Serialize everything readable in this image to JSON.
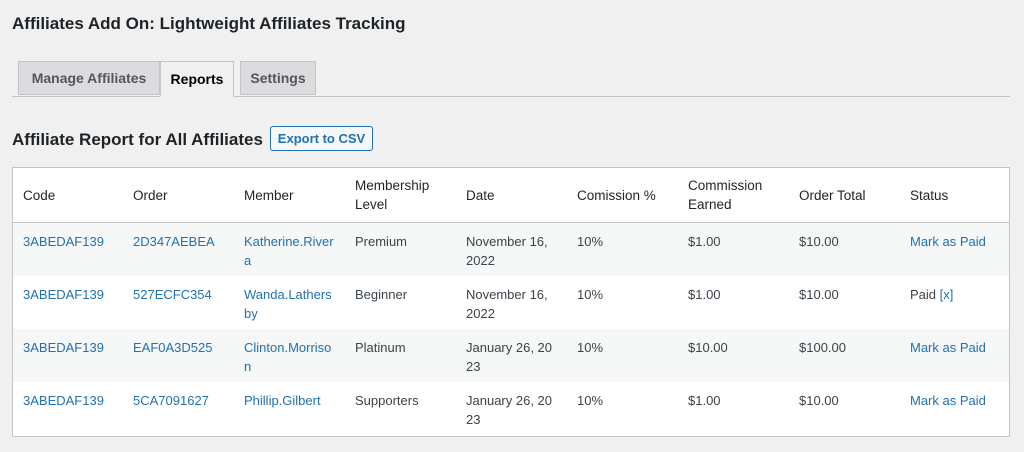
{
  "page_title": "Affiliates Add On: Lightweight Affiliates Tracking",
  "tabs": [
    {
      "label": "Manage Affiliates"
    },
    {
      "label": "Reports"
    },
    {
      "label": "Settings"
    }
  ],
  "report": {
    "title": "Affiliate Report for All Affiliates",
    "export_label": "Export to CSV"
  },
  "table": {
    "headers": [
      "Code",
      "Order",
      "Member",
      "Membership Level",
      "Date",
      "Comission %",
      "Commission Earned",
      "Order Total",
      "Status"
    ],
    "rows": [
      {
        "code": "3ABEDAF139",
        "order": "2D347AEBEA",
        "member": "Katherine.Rivera",
        "level": "Premium",
        "date": "November 16, 2022",
        "percent": "10%",
        "earned": "$1.00",
        "total": "$10.00",
        "status": "Mark as Paid",
        "status_action": ""
      },
      {
        "code": "3ABEDAF139",
        "order": "527ECFC354",
        "member": "Wanda.Lathersby",
        "level": "Beginner",
        "date": "November 16, 2022",
        "percent": "10%",
        "earned": "$1.00",
        "total": "$10.00",
        "status": "Paid",
        "status_action": "[x]"
      },
      {
        "code": "3ABEDAF139",
        "order": "EAF0A3D525",
        "member": "Clinton.Morrison",
        "level": "Platinum",
        "date": "January 26, 2023",
        "percent": "10%",
        "earned": "$10.00",
        "total": "$100.00",
        "status": "Mark as Paid",
        "status_action": ""
      },
      {
        "code": "3ABEDAF139",
        "order": "5CA7091627",
        "member": "Phillip.Gilbert",
        "level": "Supporters",
        "date": "January 26, 2023",
        "percent": "10%",
        "earned": "$1.00",
        "total": "$10.00",
        "status": "Mark as Paid",
        "status_action": ""
      }
    ]
  }
}
